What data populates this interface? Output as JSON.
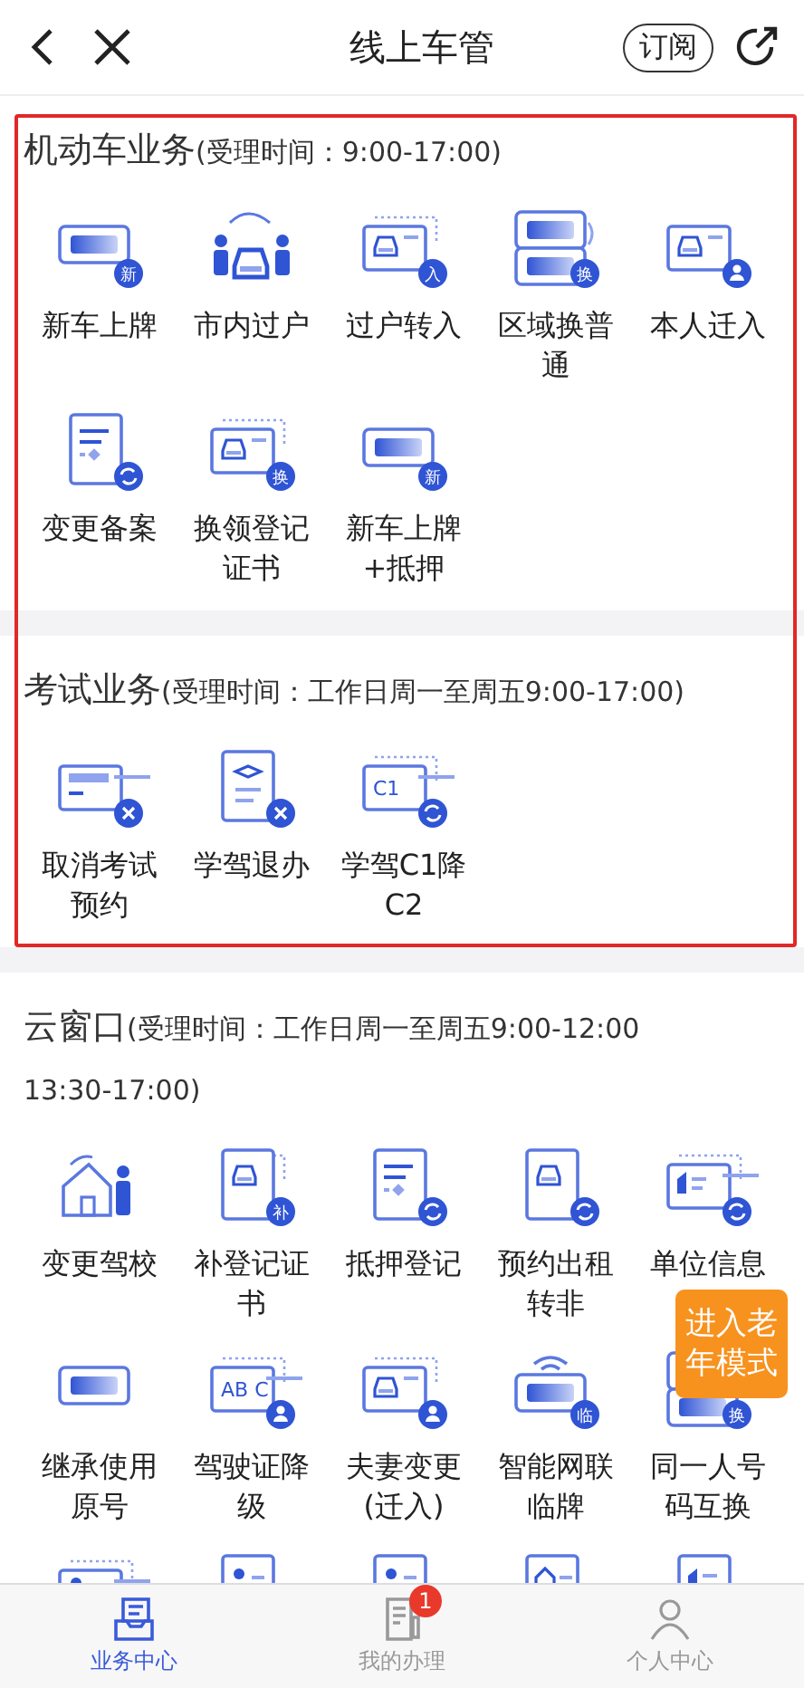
{
  "header": {
    "title": "线上车管",
    "subscribe_button": "订阅"
  },
  "sections": [
    {
      "name": "机动车业务",
      "hours": "(受理时间：9:00-17:00)",
      "highlighted": true,
      "items": [
        {
          "label": "新车上牌",
          "kind": "plate",
          "badge": "新"
        },
        {
          "label": "市内过户",
          "kind": "transfer"
        },
        {
          "label": "过户转入",
          "kind": "certificate",
          "badge": "入"
        },
        {
          "label": "区域换普通",
          "kind": "plates",
          "badge": "换"
        },
        {
          "label": "本人迁入",
          "kind": "movein"
        },
        {
          "label": "变更备案",
          "kind": "amend"
        },
        {
          "label": "换领登记证书",
          "kind": "certificate",
          "badge": "换"
        },
        {
          "label": "新车上牌+抵押",
          "kind": "plate",
          "badge": "新"
        }
      ]
    },
    {
      "name": "考试业务",
      "hours": "(受理时间：工作日周一至周五9:00-17:00)",
      "highlighted": true,
      "items": [
        {
          "label": "取消考试预约",
          "kind": "cancel"
        },
        {
          "label": "学驾退办",
          "kind": "withdraw"
        },
        {
          "label": "学驾C1降C2",
          "kind": "downgrade",
          "icon_text": "C1"
        }
      ]
    },
    {
      "name": "云窗口",
      "hours": "(受理时间：工作日周一至周五9:00-12:00 13:30-17:00)",
      "highlighted": false,
      "items": [
        {
          "label": "变更驾校",
          "kind": "school"
        },
        {
          "label": "补登记证书",
          "kind": "reissue",
          "badge": "补"
        },
        {
          "label": "抵押登记",
          "kind": "amend"
        },
        {
          "label": "预约出租转非",
          "kind": "convert"
        },
        {
          "label": "单位信息",
          "kind": "company"
        },
        {
          "label": "继承使用原号",
          "kind": "plate"
        },
        {
          "label": "驾驶证降级",
          "kind": "license",
          "icon_text": "AB C"
        },
        {
          "label": "夫妻变更(迁入)",
          "kind": "spouse"
        },
        {
          "label": "智能网联临牌",
          "kind": "signal",
          "badge": "临"
        },
        {
          "label": "同一人号码互换",
          "kind": "plates",
          "badge": "换"
        },
        {
          "kind": "idcard"
        },
        {
          "kind": "profile"
        },
        {
          "kind": "profile"
        },
        {
          "kind": "residence"
        },
        {
          "kind": "building"
        }
      ]
    }
  ],
  "floating_button": "进入老年模式",
  "tabs": [
    {
      "label": "业务中心",
      "selected": true
    },
    {
      "label": "我的办理",
      "selected": false,
      "badge": "1"
    },
    {
      "label": "个人中心",
      "selected": false
    }
  ]
}
